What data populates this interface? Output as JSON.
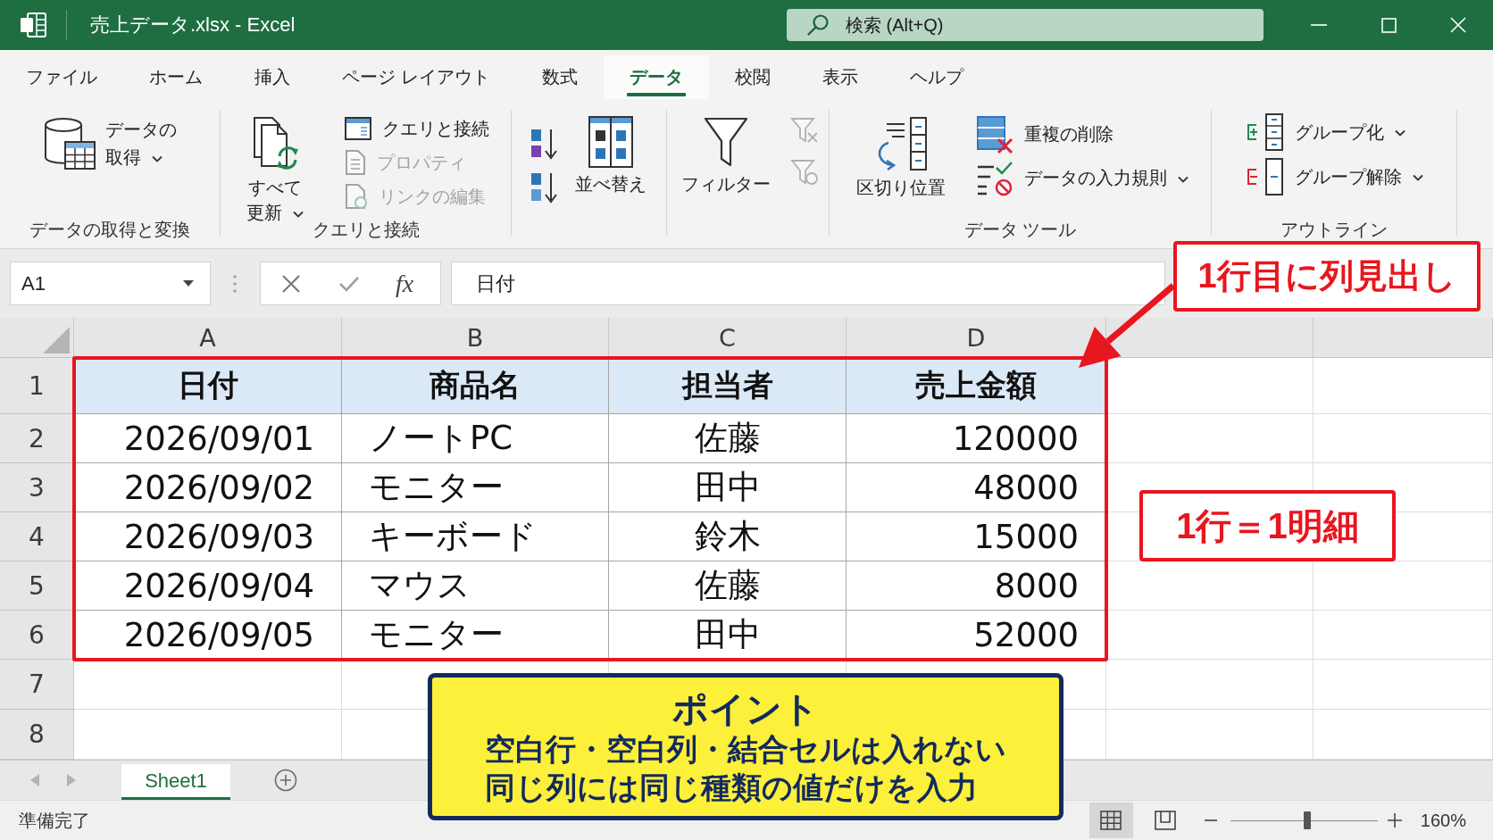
{
  "window": {
    "title": "売上データ.xlsx - Excel",
    "search": {
      "placeholder": "検索 (Alt+Q)"
    }
  },
  "ribbon_tabs": [
    {
      "label": "ファイル",
      "selected": false
    },
    {
      "label": "ホーム",
      "selected": false
    },
    {
      "label": "挿入",
      "selected": false
    },
    {
      "label": "ページ レイアウト",
      "selected": false
    },
    {
      "label": "数式",
      "selected": false
    },
    {
      "label": "データ",
      "selected": true
    },
    {
      "label": "校閲",
      "selected": false
    },
    {
      "label": "表示",
      "selected": false
    },
    {
      "label": "ヘルプ",
      "selected": false
    }
  ],
  "ribbon_groups": [
    {
      "label": "データの取得と変換",
      "items": [
        {
          "kind": "wide",
          "lines": [
            "データの",
            "取得"
          ],
          "menu": true,
          "disabled": false
        }
      ]
    },
    {
      "label": "クエリと接続",
      "items": [
        {
          "kind": "large",
          "lines": [
            "すべて",
            "更新"
          ],
          "menu": true,
          "disabled": false
        },
        {
          "kind": "small",
          "lines": [
            "クエリと接続"
          ],
          "menu": false,
          "disabled": false
        },
        {
          "kind": "small",
          "lines": [
            "プロパティ"
          ],
          "menu": false,
          "disabled": true
        },
        {
          "kind": "small",
          "lines": [
            "リンクの編集"
          ],
          "menu": false,
          "disabled": true
        }
      ]
    },
    {
      "items": [
        {
          "kind": "icon",
          "disabled": false
        },
        {
          "kind": "icon",
          "disabled": false
        },
        {
          "kind": "large",
          "lines": [
            "並べ替え"
          ],
          "menu": false,
          "disabled": false
        }
      ]
    },
    {
      "items": [
        {
          "kind": "large",
          "lines": [
            "フィルター"
          ],
          "menu": false,
          "disabled": false
        },
        {
          "kind": "icon",
          "disabled": true
        },
        {
          "kind": "icon",
          "disabled": true
        }
      ]
    },
    {
      "label": "データ ツール",
      "items": [
        {
          "kind": "large",
          "lines": [
            "区切り位置"
          ],
          "menu": false,
          "disabled": false
        },
        {
          "kind": "small",
          "lines": [
            "重複の削除"
          ],
          "menu": false,
          "disabled": false
        },
        {
          "kind": "small",
          "lines": [
            "データの入力規則"
          ],
          "menu": true,
          "disabled": false
        }
      ]
    },
    {
      "label": "アウトライン",
      "items": [
        {
          "kind": "small",
          "lines": [
            "グループ化"
          ],
          "menu": true,
          "disabled": false
        },
        {
          "kind": "small",
          "lines": [
            "グループ解除"
          ],
          "menu": true,
          "disabled": false
        }
      ]
    }
  ],
  "formula_bar": {
    "name_box": "A1",
    "function_button": "fx",
    "value": "日付"
  },
  "sheet": {
    "columns": [
      "A",
      "B",
      "C",
      "D"
    ],
    "highlighted": true,
    "rows": [
      {
        "number": "1",
        "kind": "header",
        "cells": [
          "日付",
          "商品名",
          "担当者",
          "売上金額"
        ]
      },
      {
        "number": "2",
        "kind": "data",
        "cells": [
          "2026/09/01",
          "ノートPC",
          "佐藤",
          "120000"
        ]
      },
      {
        "number": "3",
        "kind": "data",
        "cells": [
          "2026/09/02",
          "モニター",
          "田中",
          "48000"
        ]
      },
      {
        "number": "4",
        "kind": "data",
        "cells": [
          "2026/09/03",
          "キーボード",
          "鈴木",
          "15000"
        ]
      },
      {
        "number": "5",
        "kind": "data",
        "cells": [
          "2026/09/04",
          "マウス",
          "佐藤",
          "8000"
        ]
      },
      {
        "number": "6",
        "kind": "data",
        "cells": [
          "2026/09/05",
          "モニター",
          "田中",
          "52000"
        ]
      },
      {
        "number": "7",
        "kind": "empty"
      },
      {
        "number": "8",
        "kind": "empty"
      }
    ]
  },
  "sheet_tabs": [
    {
      "label": "Sheet1",
      "selected": true
    }
  ],
  "status_bar": {
    "text": "準備完了",
    "views": [
      {
        "selected": true
      },
      {
        "selected": false
      }
    ],
    "zoom": {
      "level": 0.52,
      "reading": "160%"
    }
  },
  "annotations": [
    {
      "kind": "callout",
      "text": "1行目に列見出し",
      "arrow": true
    },
    {
      "kind": "callout",
      "text": "1行＝1明細",
      "arrow": false
    },
    {
      "kind": "note",
      "title": "ポイント",
      "lines": [
        "空白行・空白列・結合セルは入れない",
        "同じ列には同じ種類の値だけを入力"
      ]
    }
  ]
}
